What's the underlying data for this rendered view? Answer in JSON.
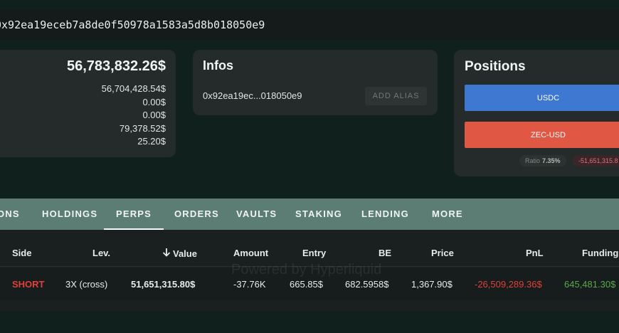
{
  "address_bar": {
    "address": "0x92ea19eceb7a8de0f50978a1583a5d8b018050e9"
  },
  "balance": {
    "total": "56,783,832.26$",
    "items": [
      "56,704,428.54$",
      "0.00$",
      "0.00$",
      "79,378.52$",
      "25.20$"
    ]
  },
  "infos": {
    "title": "Infos",
    "address_short": "0x92ea19ec...018050e9",
    "alias_button": "ADD ALIAS"
  },
  "positions": {
    "title": "Positions",
    "bars": [
      {
        "label": "USDC",
        "color": "#3f78d0"
      },
      {
        "label": "ZEC-USD",
        "color": "#e05744"
      }
    ],
    "ratio_label": "Ratio",
    "ratio_value": "7.35%",
    "pnl": "-51,651,315.8"
  },
  "tabs": [
    "ONS",
    "HOLDINGS",
    "PERPS",
    "ORDERS",
    "VAULTS",
    "STAKING",
    "LENDING",
    "MORE"
  ],
  "active_tab": "PERPS",
  "table": {
    "headers": {
      "side": "Side",
      "lev": "Lev.",
      "value": "Value",
      "amount": "Amount",
      "entry": "Entry",
      "be": "BE",
      "price": "Price",
      "pnl": "PnL",
      "funding": "Funding"
    },
    "rows": [
      {
        "side": "SHORT",
        "lev": "3X (cross)",
        "value": "51,651,315.80$",
        "amount": "-37.76K",
        "entry": "665.85$",
        "be": "682.5958$",
        "price": "1,367.90$",
        "pnl": "-26,509,289.36$",
        "funding": "645,481.30$"
      }
    ]
  },
  "watermark": "Powered by Hyperliquid",
  "colors": {
    "short": "#e0403a",
    "pnl_negative": "#e0403a",
    "funding_positive": "#5aa84e"
  }
}
